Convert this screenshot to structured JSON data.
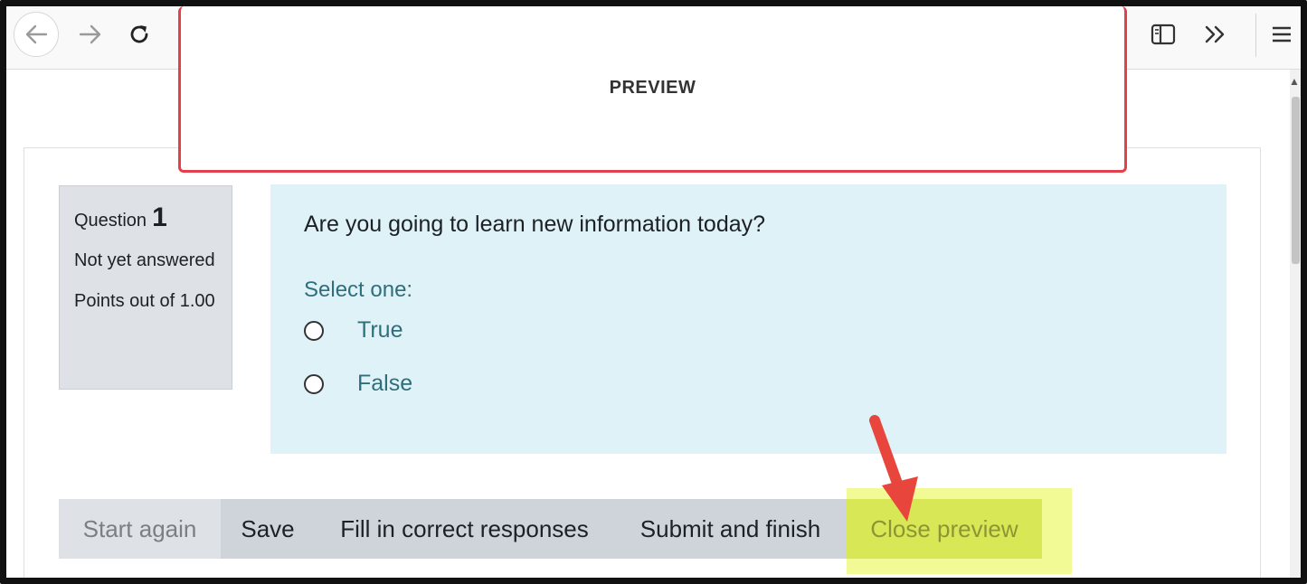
{
  "preview": {
    "title": "PREVIEW"
  },
  "question": {
    "label": "Question",
    "number": "1",
    "state": "Not yet answered",
    "grade": "Points out of 1.00",
    "text": "Are you going to learn new information today?",
    "prompt": "Select one:",
    "answers": [
      {
        "label": "True"
      },
      {
        "label": "False"
      }
    ]
  },
  "buttons": {
    "start_again": "Start again",
    "save": "Save",
    "fill_correct": "Fill in correct responses",
    "submit_finish": "Submit and finish",
    "close_preview": "Close preview"
  },
  "icons": {
    "back": "arrow-left-icon",
    "forward": "arrow-right-icon",
    "reload": "reload-icon",
    "reader": "reader-view-icon",
    "overflow": "chevron-double-right-icon",
    "menu": "hamburger-menu-icon"
  },
  "colors": {
    "preview_border": "#e2414b",
    "question_bg": "#def2f8",
    "info_bg": "#dee2e6",
    "highlight": "#e8f640",
    "arrow": "#e8453c"
  }
}
